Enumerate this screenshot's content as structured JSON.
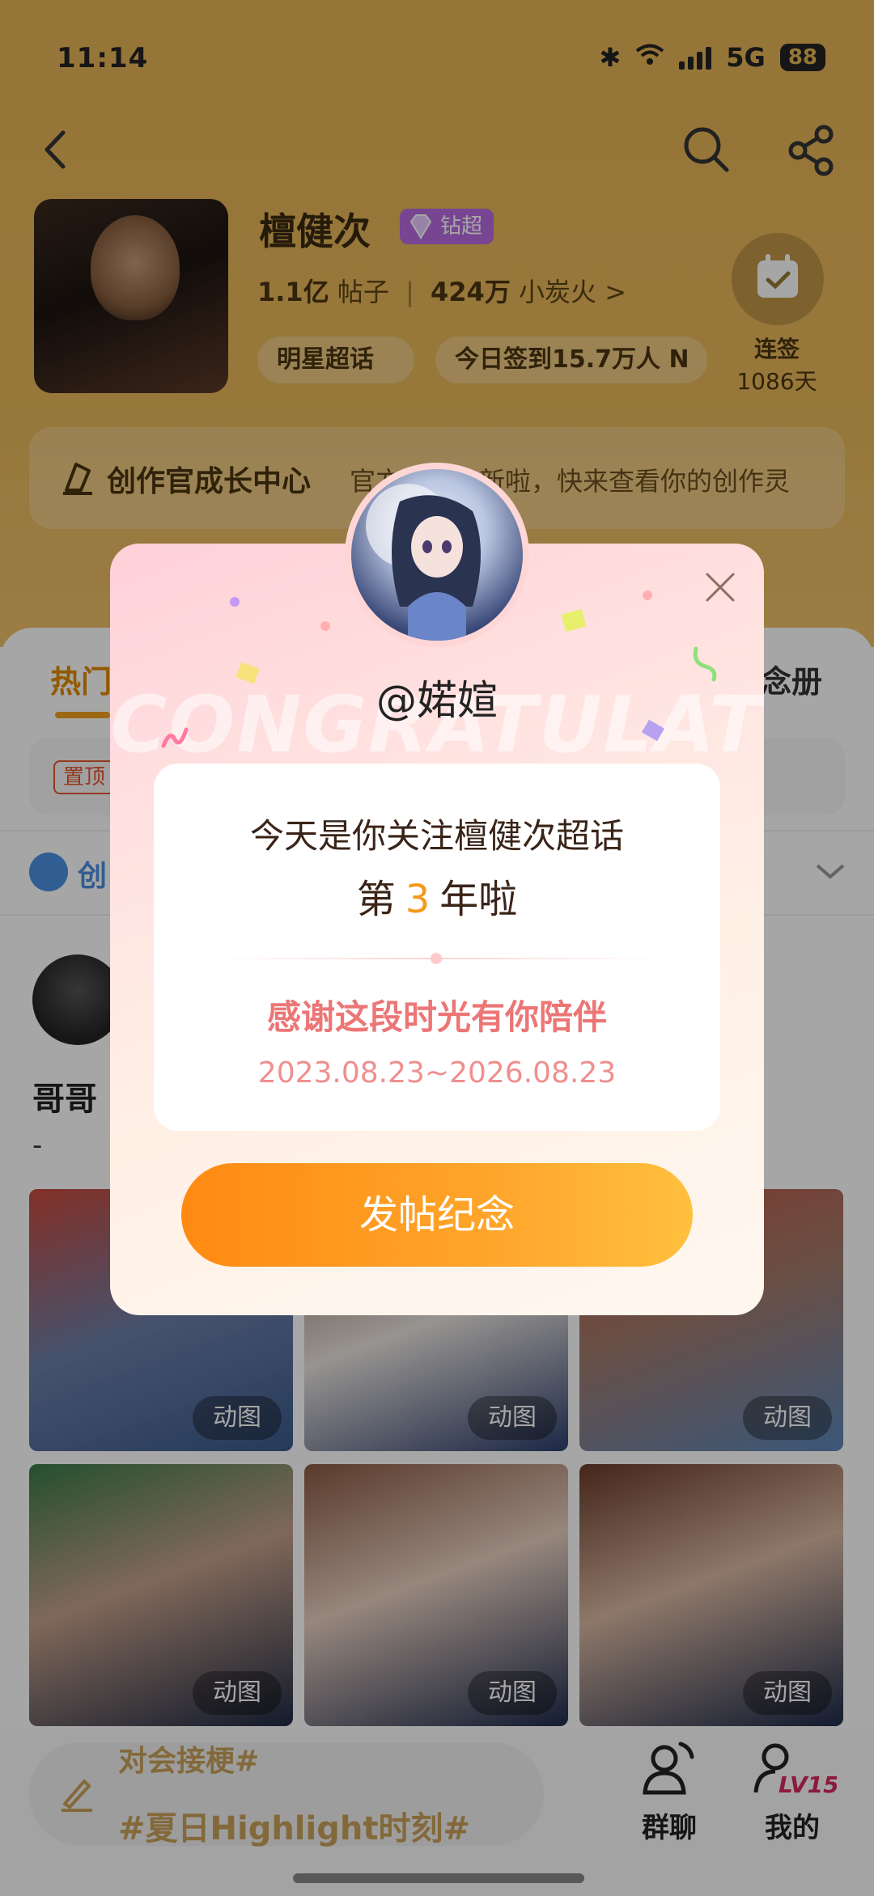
{
  "status_bar": {
    "time": "11:14",
    "network": "5G",
    "battery": "88"
  },
  "topic": {
    "name": "檀健次",
    "badge": "钻超",
    "posts_count": "1.1亿",
    "posts_label": "帖子",
    "fans_count": "424万",
    "fans_label": "小炭火",
    "fans_chevron": ">",
    "tags": [
      "明星超话",
      "今日签到15.7万人 N"
    ],
    "checkin": {
      "label": "连签",
      "days": "1086天"
    },
    "cover_title": "",
    "cover_date": ""
  },
  "growth_center": {
    "title": "创作官成长中心",
    "desc": "官方活动上新啦，快来查看你的创作灵"
  },
  "tabs": {
    "hot": "热门",
    "album": "念册"
  },
  "notice": {
    "pin_label": "置顶"
  },
  "creator_row": {
    "label": "创"
  },
  "post": {
    "title": "哥哥",
    "body": "-"
  },
  "gif_grid": {
    "items": [
      {
        "tag": "动图"
      },
      {
        "tag": "动图"
      },
      {
        "tag": "动图"
      },
      {
        "tag": "动图"
      },
      {
        "tag": "动图"
      },
      {
        "tag": "动图"
      }
    ]
  },
  "compose": {
    "line1": "对会接梗#",
    "line2": "#夏日Highlight时刻#"
  },
  "bottom_nav": {
    "group_label": "群聊",
    "me_label": "我的",
    "level": "LV15"
  },
  "modal": {
    "background_text": "CONGRATULATE",
    "username": "@婼媗",
    "line1": "今天是你关注檀健次超话",
    "line2_prefix": "第",
    "years": "3",
    "line2_suffix": "年啦",
    "thanks": "感谢这段时光有你陪伴",
    "dates": "2023.08.23~2026.08.23",
    "button": "发帖纪念"
  },
  "colors": {
    "header_bg": "#e7b656",
    "accent_orange": "#ff8a12",
    "thanks_pink": "#ec7676"
  },
  "icons": [
    "back-icon",
    "search-icon",
    "share-icon",
    "calendar-check-icon",
    "pen-icon",
    "close-icon",
    "group-chat-icon",
    "profile-icon"
  ]
}
